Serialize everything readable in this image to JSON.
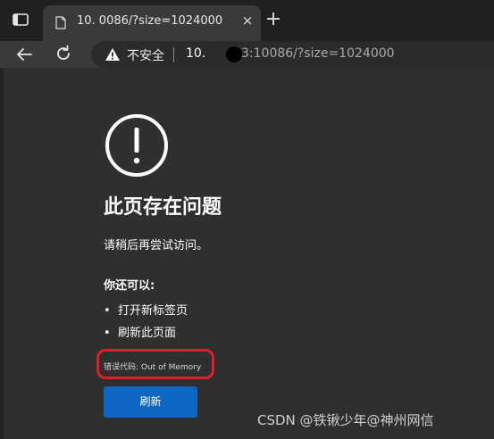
{
  "tab": {
    "title": "10.             0086/?size=1024000",
    "close": "×"
  },
  "new_tab": "+",
  "address_bar": {
    "security_label": "不安全",
    "host": "10.",
    "rest": "3:10086/?size=1024000"
  },
  "error_page": {
    "heading": "此页存在问题",
    "message": "请稍后再尝试访问。",
    "you_can": "你还可以:",
    "options": [
      "打开新标签页",
      "刷新此页面"
    ],
    "bullet": "•",
    "error_code": "错误代码: Out of Memory",
    "refresh_button": "刷新"
  },
  "watermark": "CSDN @铁锹少年@神州网信",
  "colors": {
    "accent_button": "#0c66c2",
    "annotation": "#e11d2b"
  }
}
